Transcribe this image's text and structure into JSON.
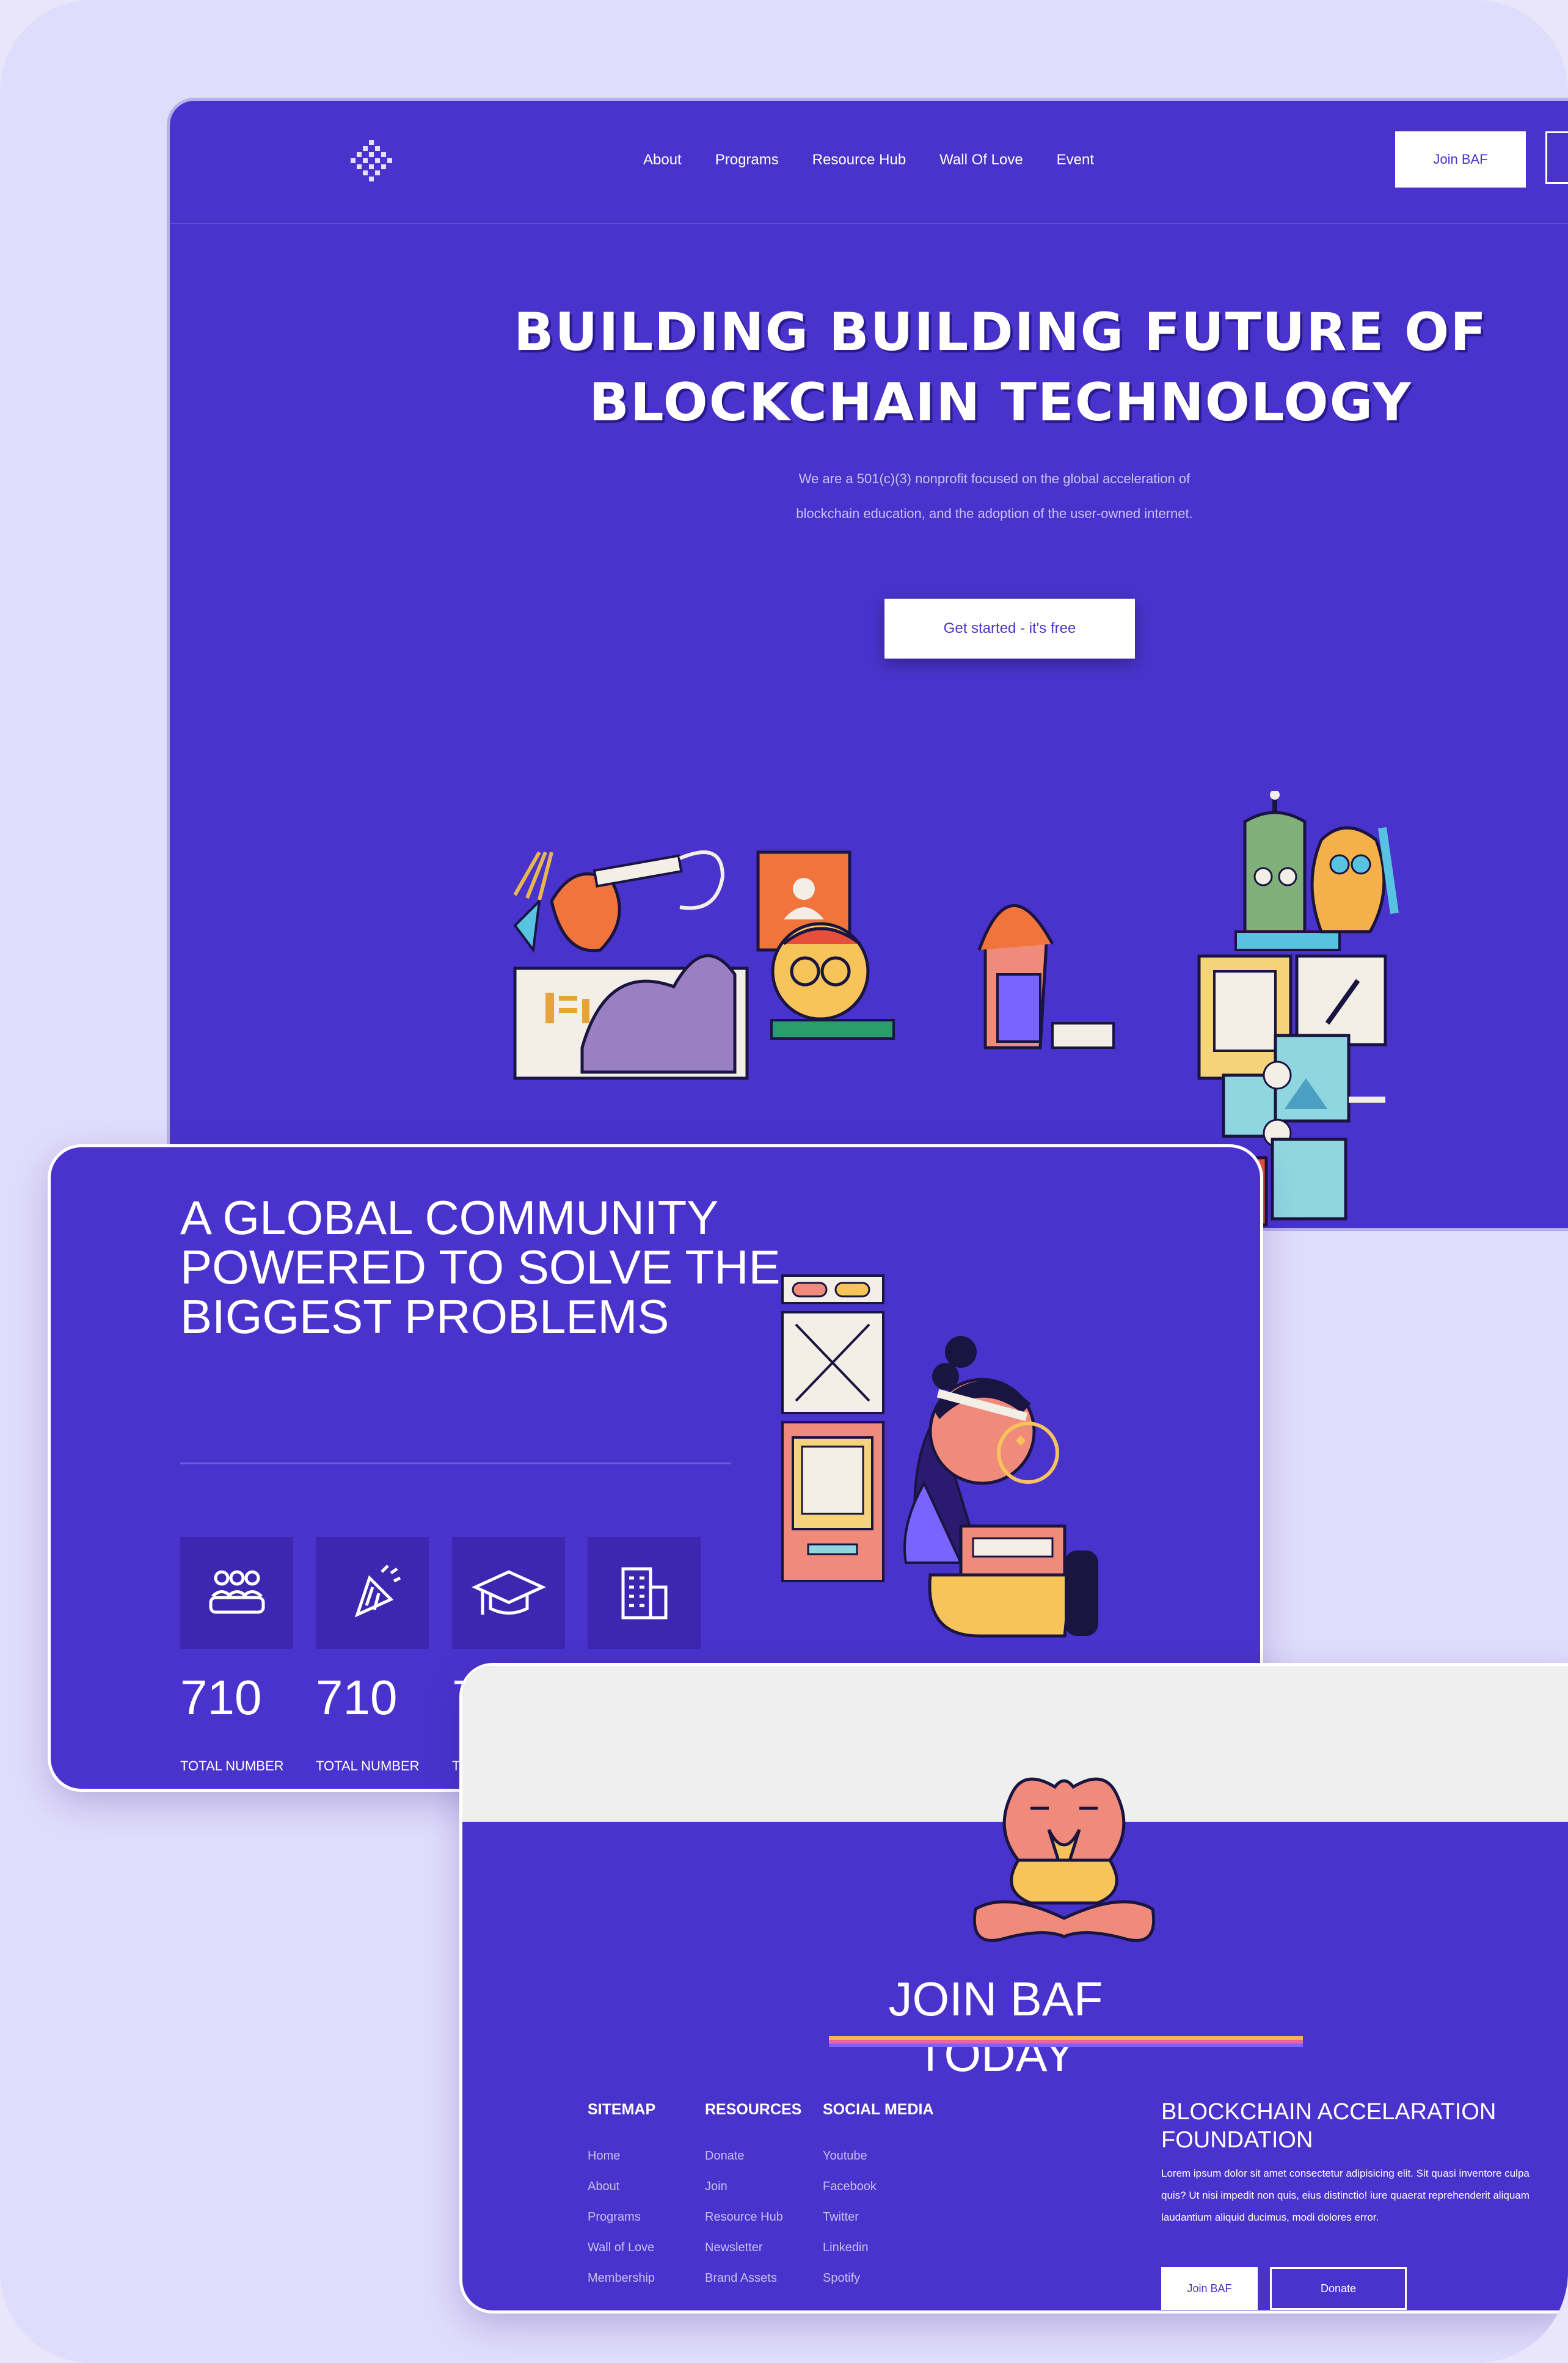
{
  "colors": {
    "brand": "#4a33cc",
    "frame": "#e0dcfc",
    "text": "#ffffff",
    "muted": "#c7bff3"
  },
  "hero": {
    "nav": {
      "links": [
        "About",
        "Programs",
        "Resource Hub",
        "Wall Of Love",
        "Event"
      ],
      "join_label": "Join BAF"
    },
    "title_line1": "BUILDING BUILDING FUTURE OF",
    "title_line2": "BLOCKCHAIN TECHNOLOGY",
    "subtitle": "We are a 501(c)(3) nonprofit focused on the global acceleration of blockchain education, and the adoption of the user-owned internet.",
    "cta_label": "Get started - it's free"
  },
  "community": {
    "title_lines": [
      "A GLOBAL COMMUNITY",
      "POWERED TO SOLVE THE",
      "BIGGEST PROBLEMS"
    ],
    "stats": [
      {
        "icon": "people-icon",
        "value": "710",
        "label": "TOTAL NUMBER"
      },
      {
        "icon": "party-popper-icon",
        "value": "710",
        "label": "TOTAL NUMBER"
      },
      {
        "icon": "graduation-cap-icon",
        "value": "7",
        "label": "T"
      },
      {
        "icon": "building-icon",
        "value": "",
        "label": ""
      }
    ]
  },
  "join": {
    "title": "JOIN BAF TODAY",
    "columns": [
      {
        "heading": "SITEMAP",
        "items": [
          "Home",
          "About",
          "Programs",
          "Wall of Love",
          "Membership"
        ]
      },
      {
        "heading": "RESOURCES",
        "items": [
          "Donate",
          "Join",
          "Resource Hub",
          "Newsletter",
          "Brand Assets"
        ]
      },
      {
        "heading": "SOCIAL MEDIA",
        "items": [
          "Youtube",
          "Facebook",
          "Twitter",
          "Linkedin",
          "Spotify"
        ]
      }
    ],
    "org_name": "BLOCKCHAIN ACCELARATION FOUNDATION",
    "org_desc": "Lorem ipsum dolor sit amet consectetur adipisicing elit. Sit quasi inventore culpa quis? Ut nisi impedit non quis, eius distinctio! iure quaerat reprehenderit aliquam laudantium aliquid ducimus, modi dolores error.",
    "join_label": "Join BAF",
    "donate_label": "Donate"
  }
}
